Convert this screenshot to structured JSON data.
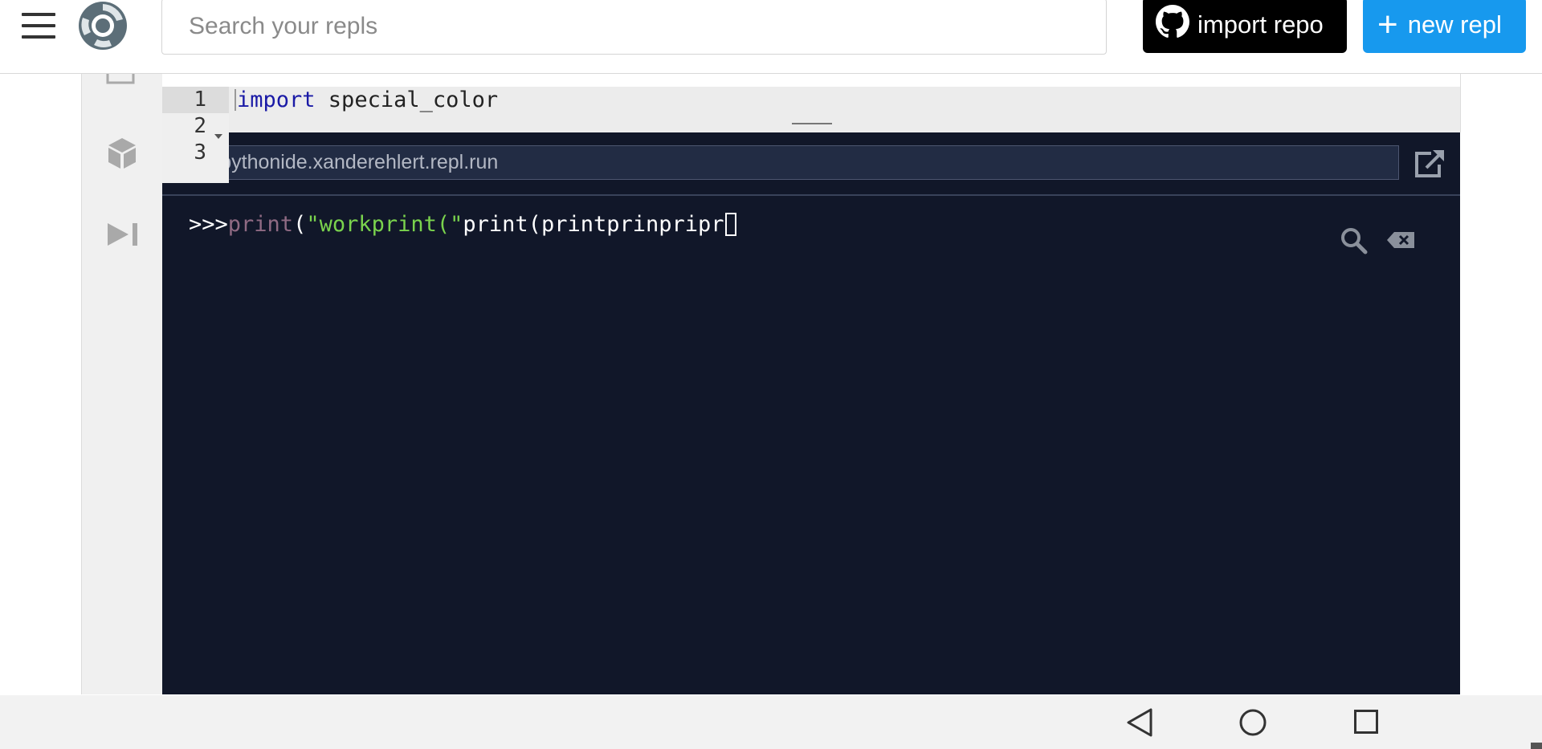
{
  "header": {
    "search_placeholder": "Search your repls",
    "import_label": "import repo",
    "new_label": "new repl",
    "new_icon": "plus-icon",
    "import_icon": "github-icon"
  },
  "sidebar": {
    "items": [
      {
        "icon": "files-icon"
      },
      {
        "icon": "packages-icon"
      },
      {
        "icon": "debugger-step-icon"
      }
    ]
  },
  "editor": {
    "line_numbers": [
      "1",
      "2",
      "3"
    ],
    "code_keyword": "import",
    "code_rest": " special_color"
  },
  "console": {
    "url": "ps://pythonide.xanderehlert.repl.run",
    "prompt": ">>>",
    "input_fn": "print",
    "input_paren": "(",
    "input_str": "\"workprint(\"",
    "input_rest": "print(printprinpripr"
  },
  "colors": {
    "accent": "#1799ee",
    "console_bg": "#111729",
    "string": "#7ad34d",
    "function": "#8f6a83",
    "keyword": "#1a1aa6"
  }
}
